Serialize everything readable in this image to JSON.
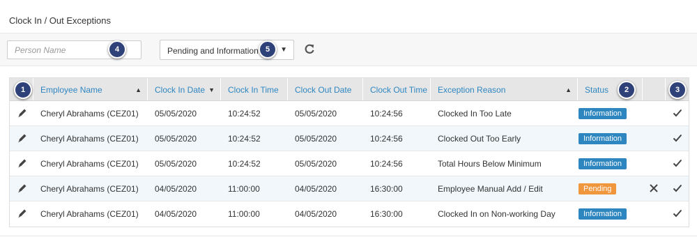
{
  "page": {
    "title": "Clock In / Out Exceptions"
  },
  "filters": {
    "search_placeholder": "Person Name",
    "status_value": "Pending and Information",
    "refresh_icon": "refresh-icon"
  },
  "callouts": [
    "1",
    "2",
    "3",
    "4",
    "5"
  ],
  "table": {
    "columns": [
      {
        "label": "Employee Name",
        "sort": "asc"
      },
      {
        "label": "Clock In Date",
        "sort": "desc"
      },
      {
        "label": "Clock In Time",
        "sort": ""
      },
      {
        "label": "Clock Out Date",
        "sort": ""
      },
      {
        "label": "Clock Out Time",
        "sort": ""
      },
      {
        "label": "Exception Reason",
        "sort": "asc"
      },
      {
        "label": "Status",
        "sort": ""
      }
    ],
    "rows": [
      {
        "employee": "Cheryl Abrahams (CEZ01)",
        "clock_in_date": "05/05/2020",
        "clock_in_time": "10:24:52",
        "clock_out_date": "05/05/2020",
        "clock_out_time": "10:24:56",
        "reason": "Clocked In Too Late",
        "status": "Information"
      },
      {
        "employee": "Cheryl Abrahams (CEZ01)",
        "clock_in_date": "05/05/2020",
        "clock_in_time": "10:24:52",
        "clock_out_date": "05/05/2020",
        "clock_out_time": "10:24:56",
        "reason": "Clocked Out Too Early",
        "status": "Information"
      },
      {
        "employee": "Cheryl Abrahams (CEZ01)",
        "clock_in_date": "05/05/2020",
        "clock_in_time": "10:24:52",
        "clock_out_date": "05/05/2020",
        "clock_out_time": "10:24:56",
        "reason": "Total Hours Below Minimum",
        "status": "Information"
      },
      {
        "employee": "Cheryl Abrahams (CEZ01)",
        "clock_in_date": "04/05/2020",
        "clock_in_time": "11:00:00",
        "clock_out_date": "04/05/2020",
        "clock_out_time": "16:30:00",
        "reason": "Employee Manual Add / Edit",
        "status": "Pending"
      },
      {
        "employee": "Cheryl Abrahams (CEZ01)",
        "clock_in_date": "04/05/2020",
        "clock_in_time": "11:00:00",
        "clock_out_date": "04/05/2020",
        "clock_out_time": "16:30:00",
        "reason": "Clocked In on Non-working Day",
        "status": "Information"
      }
    ]
  },
  "colors": {
    "link_blue": "#2e86c1",
    "information": "#2e86c1",
    "pending": "#f0963c",
    "callout": "#2f4179",
    "row_alt": "#f1f7fb",
    "header_bg": "#e6e6e6"
  }
}
